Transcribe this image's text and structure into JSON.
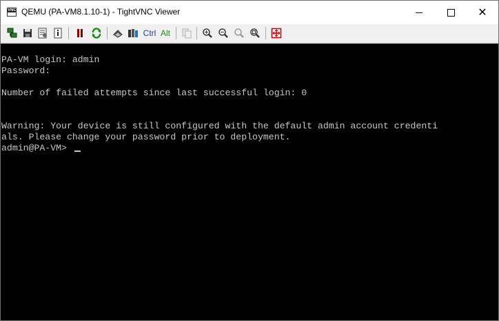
{
  "window": {
    "title": "QEMU (PA-VM8.1.10-1) - TightVNC Viewer",
    "app_icon_label": "VNC"
  },
  "toolbar": {
    "items": [
      {
        "name": "new-connection-icon"
      },
      {
        "name": "save-icon"
      },
      {
        "name": "options-icon"
      },
      {
        "name": "connection-info-icon"
      },
      {
        "name": "pause-icon"
      },
      {
        "name": "refresh-icon"
      },
      {
        "name": "ctrl-alt-del-icon"
      },
      {
        "name": "ctrl-esc-icon"
      },
      {
        "name": "ctrl-key",
        "label": "Ctrl"
      },
      {
        "name": "alt-key",
        "label": "Alt"
      },
      {
        "name": "copy-clipboard-icon"
      },
      {
        "name": "zoom-in-icon"
      },
      {
        "name": "zoom-out-icon"
      },
      {
        "name": "zoom-100-icon"
      },
      {
        "name": "zoom-fit-icon"
      },
      {
        "name": "fullscreen-icon"
      }
    ],
    "ctrl_label": "Ctrl",
    "alt_label": "Alt"
  },
  "terminal": {
    "lines": [
      "PA-VM login: admin",
      "Password:",
      "",
      "Number of failed attempts since last successful login: 0",
      "",
      "",
      "Warning: Your device is still configured with the default admin account credenti",
      "als. Please change your password prior to deployment.",
      "admin@PA-VM> "
    ]
  }
}
